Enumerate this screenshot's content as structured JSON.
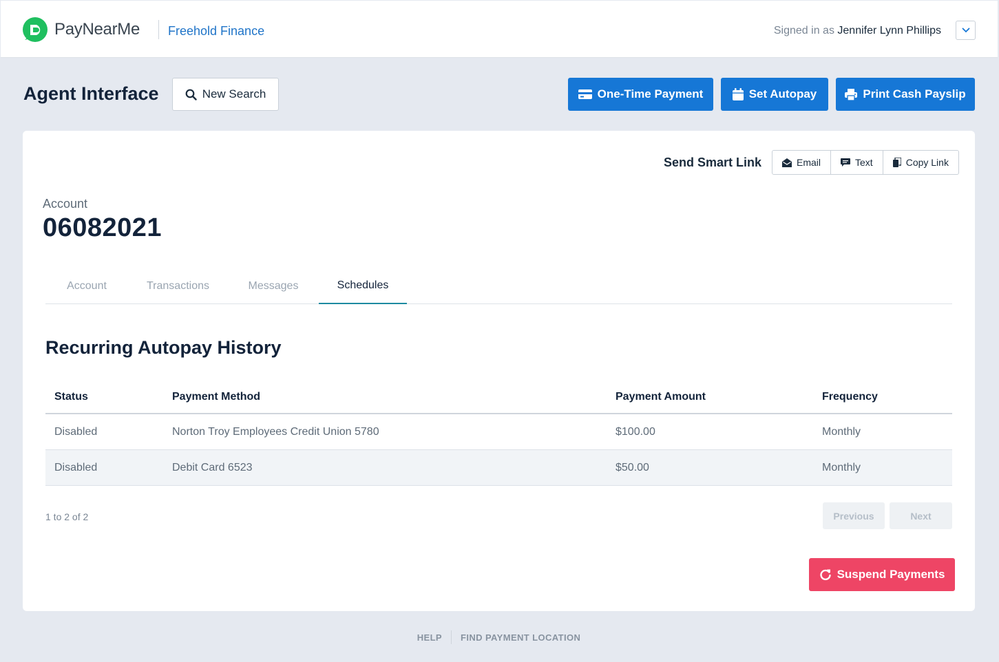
{
  "header": {
    "brand_name": "PayNearMe",
    "merchant_name": "Freehold Finance",
    "signed_in_prefix": "Signed in as",
    "user_name": "Jennifer Lynn Phillips"
  },
  "toolbar": {
    "page_title": "Agent Interface",
    "new_search_label": "New Search",
    "one_time_payment_label": "One-Time Payment",
    "set_autopay_label": "Set Autopay",
    "print_payslip_label": "Print Cash Payslip"
  },
  "smart_link": {
    "label": "Send Smart Link",
    "email_label": "Email",
    "text_label": "Text",
    "copy_label": "Copy Link"
  },
  "account": {
    "label": "Account",
    "number": "06082021"
  },
  "tabs": [
    {
      "label": "Account",
      "active": false
    },
    {
      "label": "Transactions",
      "active": false
    },
    {
      "label": "Messages",
      "active": false
    },
    {
      "label": "Schedules",
      "active": true
    }
  ],
  "history": {
    "title": "Recurring Autopay History",
    "columns": [
      "Status",
      "Payment Method",
      "Payment Amount",
      "Frequency"
    ],
    "rows": [
      {
        "status": "Disabled",
        "method": "Norton Troy Employees Credit Union 5780",
        "amount": "$100.00",
        "frequency": "Monthly"
      },
      {
        "status": "Disabled",
        "method": "Debit Card 6523",
        "amount": "$50.00",
        "frequency": "Monthly"
      }
    ],
    "pager_info": "1 to 2 of 2",
    "previous_label": "Previous",
    "next_label": "Next"
  },
  "suspend_label": "Suspend Payments",
  "footer": {
    "help_label": "HELP",
    "find_location_label": "FIND PAYMENT LOCATION"
  },
  "colors": {
    "primary": "#1677d6",
    "danger": "#ee4565",
    "brand_green": "#1fbf5f",
    "page_bg": "#e5e9f0"
  }
}
